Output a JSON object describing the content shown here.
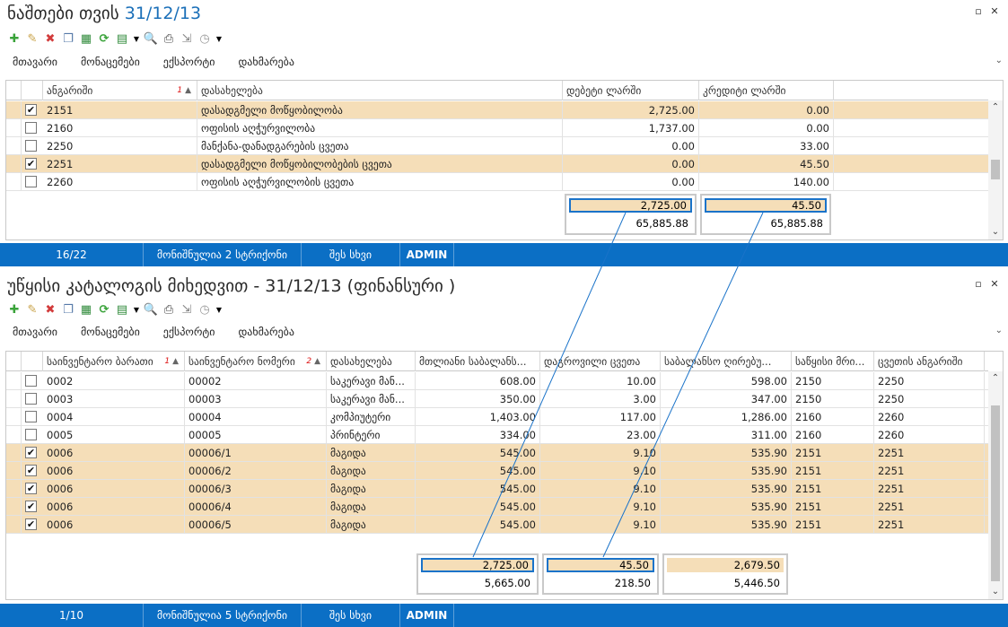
{
  "panel1": {
    "title_prefix": "ნაშთები თვის",
    "title_date": "31/12/13",
    "menu": [
      "მთავარი",
      "მონაცემები",
      "ექსპორტი",
      "დახმარება"
    ],
    "columns": [
      "ანგარიში",
      "დასახელება",
      "დებეტი ლარში",
      "კრედიტი ლარში"
    ],
    "sort_marker": "1",
    "rows": [
      {
        "checked": true,
        "code": "2151",
        "name": "დასადგმელი მოწყობილობა",
        "debit": "2,725.00",
        "credit": "0.00"
      },
      {
        "checked": false,
        "code": "2160",
        "name": "ოფისის აღჭურვილობა",
        "debit": "1,737.00",
        "credit": "0.00"
      },
      {
        "checked": false,
        "code": "2250",
        "name": "მანქანა-დანადგარების ცვეთა",
        "debit": "0.00",
        "credit": "33.00"
      },
      {
        "checked": true,
        "code": "2251",
        "name": "დასადგმელი მოწყობილობების ცვეთა",
        "debit": "0.00",
        "credit": "45.50"
      },
      {
        "checked": false,
        "code": "2260",
        "name": "ოფისის აღჭურვილობის ცვეთა",
        "debit": "0.00",
        "credit": "140.00"
      }
    ],
    "summary": {
      "debit_selected": "2,725.00",
      "debit_total": "65,885.88",
      "credit_selected": "45.50",
      "credit_total": "65,885.88"
    },
    "status": {
      "position": "16/22",
      "marked": "მონიშნულია 2 სტრიქონი",
      "list": "შეს სხვი",
      "user": "ADMIN"
    }
  },
  "panel2": {
    "title_prefix": "უწყისი კატალოგის მიხედვით - ",
    "title_date": "31/12/13",
    "title_suffix": " (ფინანსური )",
    "menu": [
      "მთავარი",
      "მონაცემები",
      "ექსპორტი",
      "დახმარება"
    ],
    "columns": [
      "საინვენტარო ბარათი",
      "საინვენტარო ნომერი",
      "დასახელება",
      "მთლიანი საბალანს...",
      "დაგროვილი ცვეთა",
      "საბალანსო ღირებუ...",
      "საწყისი მრი...",
      "ცვეთის ანგარიში"
    ],
    "sort_marker_1": "1",
    "sort_marker_2": "2",
    "rows": [
      {
        "checked": false,
        "card": "0002",
        "inv": "00002",
        "name": "საკერავი მან...",
        "total": "608.00",
        "dep": "10.00",
        "bal": "598.00",
        "acc": "2150",
        "depacc": "2250"
      },
      {
        "checked": false,
        "card": "0003",
        "inv": "00003",
        "name": "საკერავი მან...",
        "total": "350.00",
        "dep": "3.00",
        "bal": "347.00",
        "acc": "2150",
        "depacc": "2250"
      },
      {
        "checked": false,
        "card": "0004",
        "inv": "00004",
        "name": "კომპიუტერი",
        "total": "1,403.00",
        "dep": "117.00",
        "bal": "1,286.00",
        "acc": "2160",
        "depacc": "2260"
      },
      {
        "checked": false,
        "card": "0005",
        "inv": "00005",
        "name": "პრინტერი",
        "total": "334.00",
        "dep": "23.00",
        "bal": "311.00",
        "acc": "2160",
        "depacc": "2260"
      },
      {
        "checked": true,
        "card": "0006",
        "inv": "00006/1",
        "name": "მაგიდა",
        "total": "545.00",
        "dep": "9.10",
        "bal": "535.90",
        "acc": "2151",
        "depacc": "2251"
      },
      {
        "checked": true,
        "card": "0006",
        "inv": "00006/2",
        "name": "მაგიდა",
        "total": "545.00",
        "dep": "9.10",
        "bal": "535.90",
        "acc": "2151",
        "depacc": "2251"
      },
      {
        "checked": true,
        "card": "0006",
        "inv": "00006/3",
        "name": "მაგიდა",
        "total": "545.00",
        "dep": "9.10",
        "bal": "535.90",
        "acc": "2151",
        "depacc": "2251"
      },
      {
        "checked": true,
        "card": "0006",
        "inv": "00006/4",
        "name": "მაგიდა",
        "total": "545.00",
        "dep": "9.10",
        "bal": "535.90",
        "acc": "2151",
        "depacc": "2251"
      },
      {
        "checked": true,
        "card": "0006",
        "inv": "00006/5",
        "name": "მაგიდა",
        "total": "545.00",
        "dep": "9.10",
        "bal": "535.90",
        "acc": "2151",
        "depacc": "2251"
      }
    ],
    "summary": {
      "total_selected": "2,725.00",
      "total_all": "5,665.00",
      "dep_selected": "45.50",
      "dep_all": "218.50",
      "bal_selected": "2,679.50",
      "bal_all": "5,446.50"
    },
    "status": {
      "position": "1/10",
      "marked": "მონიშნულია 5 სტრიქონი",
      "list": "შეს სხვი",
      "user": "ADMIN"
    }
  },
  "colors": {
    "selected_row": "#f5deb8",
    "status_bar": "#0b6fc5",
    "link_line": "#1a73c9"
  },
  "icons": [
    "add-icon",
    "edit-icon",
    "delete-icon",
    "copy-icon",
    "excel-icon",
    "refresh-icon",
    "grid-icon",
    "dropdown-icon",
    "preview-icon",
    "print-icon",
    "export-icon",
    "clock-icon",
    "more-icon"
  ]
}
